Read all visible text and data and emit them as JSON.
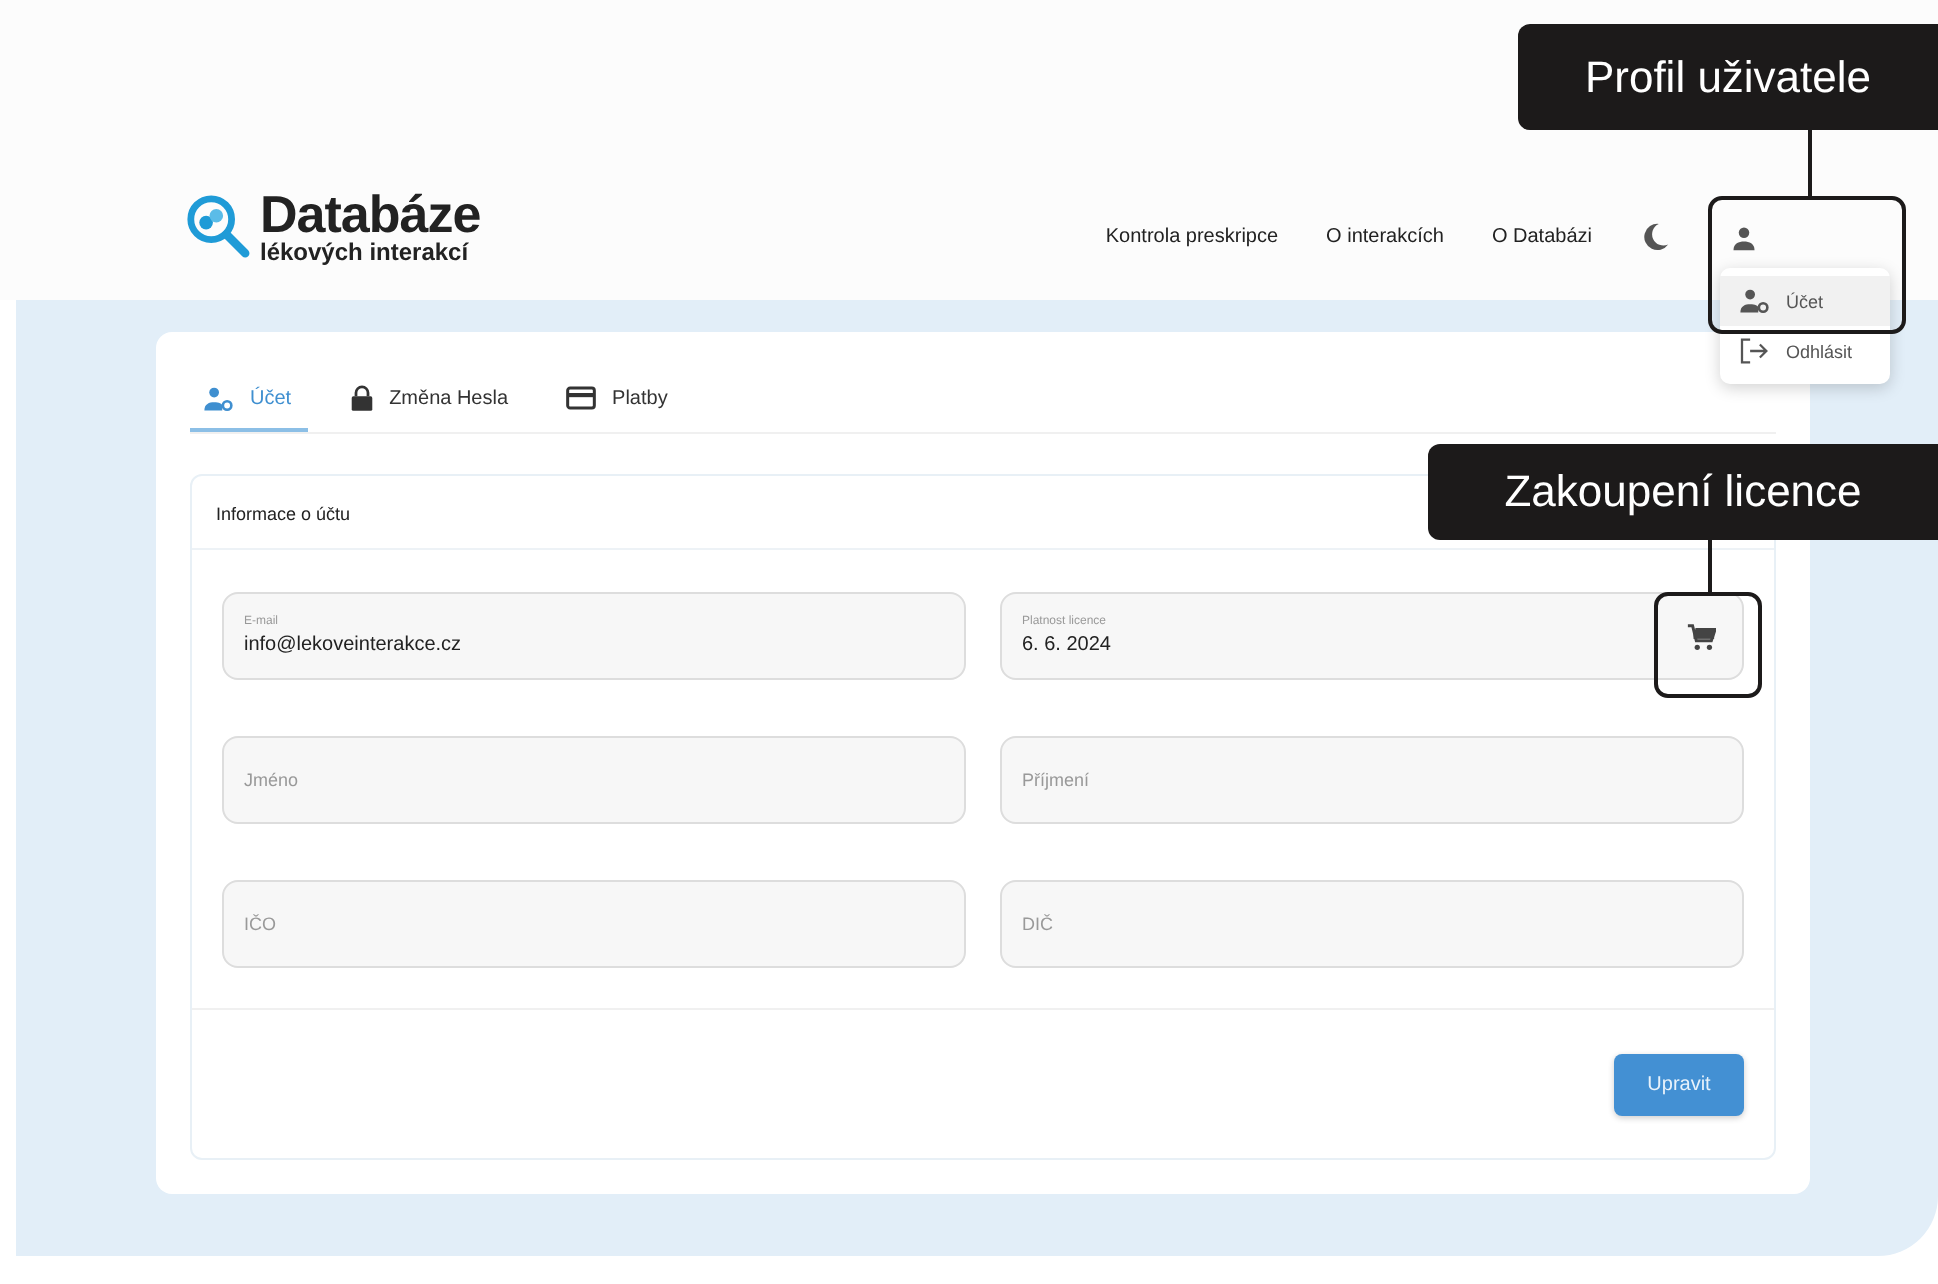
{
  "header": {
    "logo": {
      "title": "Databáze",
      "subtitle": "lékových interakcí"
    },
    "nav": [
      "Kontrola preskripce",
      "O interakcích",
      "O Databázi"
    ],
    "user_menu": {
      "items": [
        {
          "label": "Účet",
          "kind": "user-gear",
          "selected": true
        },
        {
          "label": "Odhlásit",
          "kind": "logout",
          "selected": false
        }
      ]
    }
  },
  "tabs": [
    {
      "label": "Účet",
      "kind": "user-gear",
      "selected": true
    },
    {
      "label": "Změna Hesla",
      "kind": "lock",
      "selected": false
    },
    {
      "label": "Platby",
      "kind": "card",
      "selected": false
    }
  ],
  "panel": {
    "title": "Informace o účtu",
    "fields": [
      {
        "label": "E-mail",
        "value": "info@lekoveinterakce.cz",
        "has_cart": false
      },
      {
        "label": "Platnost licence",
        "value": "6. 6. 2024",
        "has_cart": true
      },
      {
        "placeholder": "Jméno",
        "has_cart": false
      },
      {
        "placeholder": "Příjmení",
        "has_cart": false
      },
      {
        "placeholder": "IČO",
        "has_cart": false
      },
      {
        "placeholder": "DIČ",
        "has_cart": false
      }
    ],
    "button": "Upravit"
  },
  "callouts": [
    {
      "text": "Profil uživatele"
    },
    {
      "text": "Zakoupení licence"
    }
  ]
}
